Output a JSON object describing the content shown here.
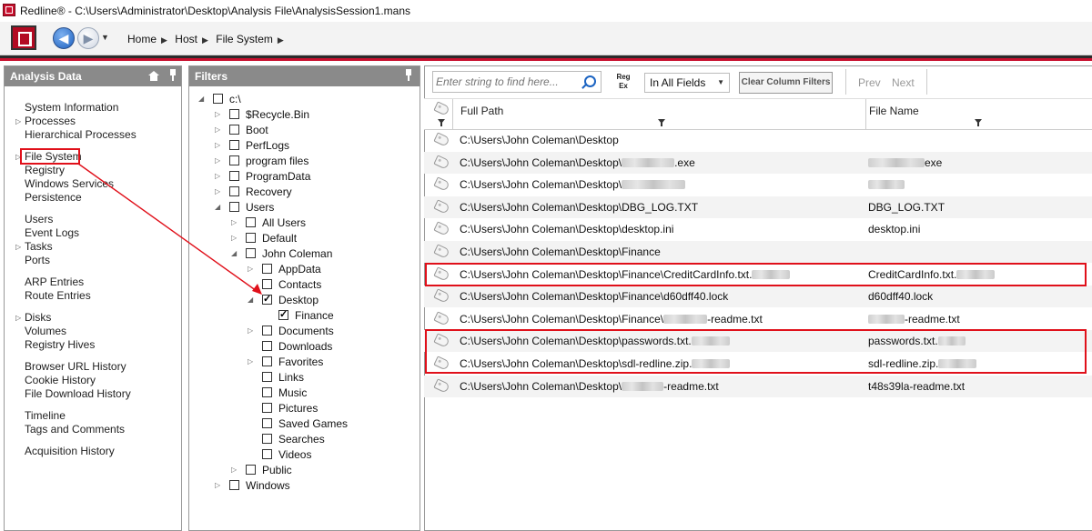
{
  "window": {
    "title": "Redline® - C:\\Users\\Administrator\\Desktop\\Analysis File\\AnalysisSession1.mans"
  },
  "breadcrumb": [
    "Home",
    "Host",
    "File System"
  ],
  "analysis_panel": {
    "title": "Analysis Data",
    "groups": [
      [
        {
          "label": "System Information",
          "expandable": false
        },
        {
          "label": "Processes",
          "expandable": true
        },
        {
          "label": "Hierarchical Processes",
          "expandable": false
        }
      ],
      [
        {
          "label": "File System",
          "expandable": true,
          "selected": true
        },
        {
          "label": "Registry",
          "expandable": false
        },
        {
          "label": "Windows Services",
          "expandable": false
        },
        {
          "label": "Persistence",
          "expandable": false
        }
      ],
      [
        {
          "label": "Users",
          "expandable": false
        },
        {
          "label": "Event Logs",
          "expandable": false
        },
        {
          "label": "Tasks",
          "expandable": true
        },
        {
          "label": "Ports",
          "expandable": false
        }
      ],
      [
        {
          "label": "ARP Entries",
          "expandable": false
        },
        {
          "label": "Route Entries",
          "expandable": false
        }
      ],
      [
        {
          "label": "Disks",
          "expandable": true
        },
        {
          "label": "Volumes",
          "expandable": false
        },
        {
          "label": "Registry Hives",
          "expandable": false
        }
      ],
      [
        {
          "label": "Browser URL History",
          "expandable": false
        },
        {
          "label": "Cookie History",
          "expandable": false
        },
        {
          "label": "File Download History",
          "expandable": false
        }
      ],
      [
        {
          "label": "Timeline",
          "expandable": false
        },
        {
          "label": "Tags and Comments",
          "expandable": false
        }
      ],
      [
        {
          "label": "Acquisition History",
          "expandable": false
        }
      ]
    ]
  },
  "filters_panel": {
    "title": "Filters",
    "tree": [
      {
        "label": "c:\\",
        "level": 0,
        "toggle": "open",
        "checked": false
      },
      {
        "label": "$Recycle.Bin",
        "level": 1,
        "toggle": "closed",
        "checked": false
      },
      {
        "label": "Boot",
        "level": 1,
        "toggle": "closed",
        "checked": false
      },
      {
        "label": "PerfLogs",
        "level": 1,
        "toggle": "closed",
        "checked": false
      },
      {
        "label": "program files",
        "level": 1,
        "toggle": "closed",
        "checked": false
      },
      {
        "label": "ProgramData",
        "level": 1,
        "toggle": "closed",
        "checked": false
      },
      {
        "label": "Recovery",
        "level": 1,
        "toggle": "closed",
        "checked": false
      },
      {
        "label": "Users",
        "level": 1,
        "toggle": "open",
        "checked": false
      },
      {
        "label": "All Users",
        "level": 2,
        "toggle": "closed",
        "checked": false
      },
      {
        "label": "Default",
        "level": 2,
        "toggle": "closed",
        "checked": false
      },
      {
        "label": "John Coleman",
        "level": 2,
        "toggle": "open",
        "checked": false
      },
      {
        "label": "AppData",
        "level": 3,
        "toggle": "closed",
        "checked": false
      },
      {
        "label": "Contacts",
        "level": 3,
        "toggle": "none",
        "checked": false
      },
      {
        "label": "Desktop",
        "level": 3,
        "toggle": "open",
        "checked": true
      },
      {
        "label": "Finance",
        "level": 4,
        "toggle": "none",
        "checked": true
      },
      {
        "label": "Documents",
        "level": 3,
        "toggle": "closed",
        "checked": false
      },
      {
        "label": "Downloads",
        "level": 3,
        "toggle": "none",
        "checked": false
      },
      {
        "label": "Favorites",
        "level": 3,
        "toggle": "closed",
        "checked": false
      },
      {
        "label": "Links",
        "level": 3,
        "toggle": "none",
        "checked": false
      },
      {
        "label": "Music",
        "level": 3,
        "toggle": "none",
        "checked": false
      },
      {
        "label": "Pictures",
        "level": 3,
        "toggle": "none",
        "checked": false
      },
      {
        "label": "Saved Games",
        "level": 3,
        "toggle": "none",
        "checked": false
      },
      {
        "label": "Searches",
        "level": 3,
        "toggle": "none",
        "checked": false
      },
      {
        "label": "Videos",
        "level": 3,
        "toggle": "none",
        "checked": false
      },
      {
        "label": "Public",
        "level": 2,
        "toggle": "closed",
        "checked": false
      },
      {
        "label": "Windows",
        "level": 1,
        "toggle": "closed",
        "checked": false
      }
    ]
  },
  "search": {
    "placeholder": "Enter string to find here...",
    "regex_label_top": "Reg",
    "regex_label_bottom": "Ex",
    "field_scope": "In All Fields",
    "clear_filters_label": "Clear Column Filters",
    "prev_label": "Prev",
    "next_label": "Next"
  },
  "grid": {
    "columns": [
      "Full Path",
      "File Name"
    ],
    "rows": [
      {
        "path": "C:\\Users\\John Coleman\\Desktop",
        "path_suffix": "",
        "name": "",
        "name_suffix": "",
        "redact_path": 0,
        "redact_name": 0
      },
      {
        "path": "C:\\Users\\John Coleman\\Desktop\\",
        "path_suffix": ".exe",
        "name": "",
        "name_suffix": "exe",
        "redact_path": 58,
        "redact_name": 62
      },
      {
        "path": "C:\\Users\\John Coleman\\Desktop\\",
        "path_suffix": "",
        "name": "",
        "name_suffix": "",
        "redact_path": 70,
        "redact_name": 40
      },
      {
        "path": "C:\\Users\\John Coleman\\Desktop\\DBG_LOG.TXT",
        "path_suffix": "",
        "name": "DBG_LOG.TXT",
        "name_suffix": "",
        "redact_path": 0,
        "redact_name": 0
      },
      {
        "path": "C:\\Users\\John Coleman\\Desktop\\desktop.ini",
        "path_suffix": "",
        "name": "desktop.ini",
        "name_suffix": "",
        "redact_path": 0,
        "redact_name": 0
      },
      {
        "path": "C:\\Users\\John Coleman\\Desktop\\Finance",
        "path_suffix": "",
        "name": "",
        "name_suffix": "",
        "redact_path": 0,
        "redact_name": 0
      },
      {
        "path": "C:\\Users\\John Coleman\\Desktop\\Finance\\CreditCardInfo.txt.",
        "path_suffix": "",
        "name": "CreditCardInfo.txt.",
        "name_suffix": "",
        "redact_path": 42,
        "redact_name": 42
      },
      {
        "path": "C:\\Users\\John Coleman\\Desktop\\Finance\\d60dff40.lock",
        "path_suffix": "",
        "name": "d60dff40.lock",
        "name_suffix": "",
        "redact_path": 0,
        "redact_name": 0
      },
      {
        "path": "C:\\Users\\John Coleman\\Desktop\\Finance\\",
        "path_suffix": "-readme.txt",
        "name": "",
        "name_suffix": "-readme.txt",
        "redact_path": 48,
        "redact_name": 40
      },
      {
        "path": "C:\\Users\\John Coleman\\Desktop\\passwords.txt.",
        "path_suffix": "",
        "name": "passwords.txt.",
        "name_suffix": "",
        "redact_path": 42,
        "redact_name": 30
      },
      {
        "path": "C:\\Users\\John Coleman\\Desktop\\sdl-redline.zip.",
        "path_suffix": "",
        "name": "sdl-redline.zip.",
        "name_suffix": "",
        "redact_path": 42,
        "redact_name": 42
      },
      {
        "path": "C:\\Users\\John Coleman\\Desktop\\",
        "path_suffix": "-readme.txt",
        "name": "t48s39la-readme.txt",
        "name_suffix": "",
        "redact_path": 46,
        "redact_name": 0
      }
    ]
  },
  "highlight_color": "#e0101a"
}
